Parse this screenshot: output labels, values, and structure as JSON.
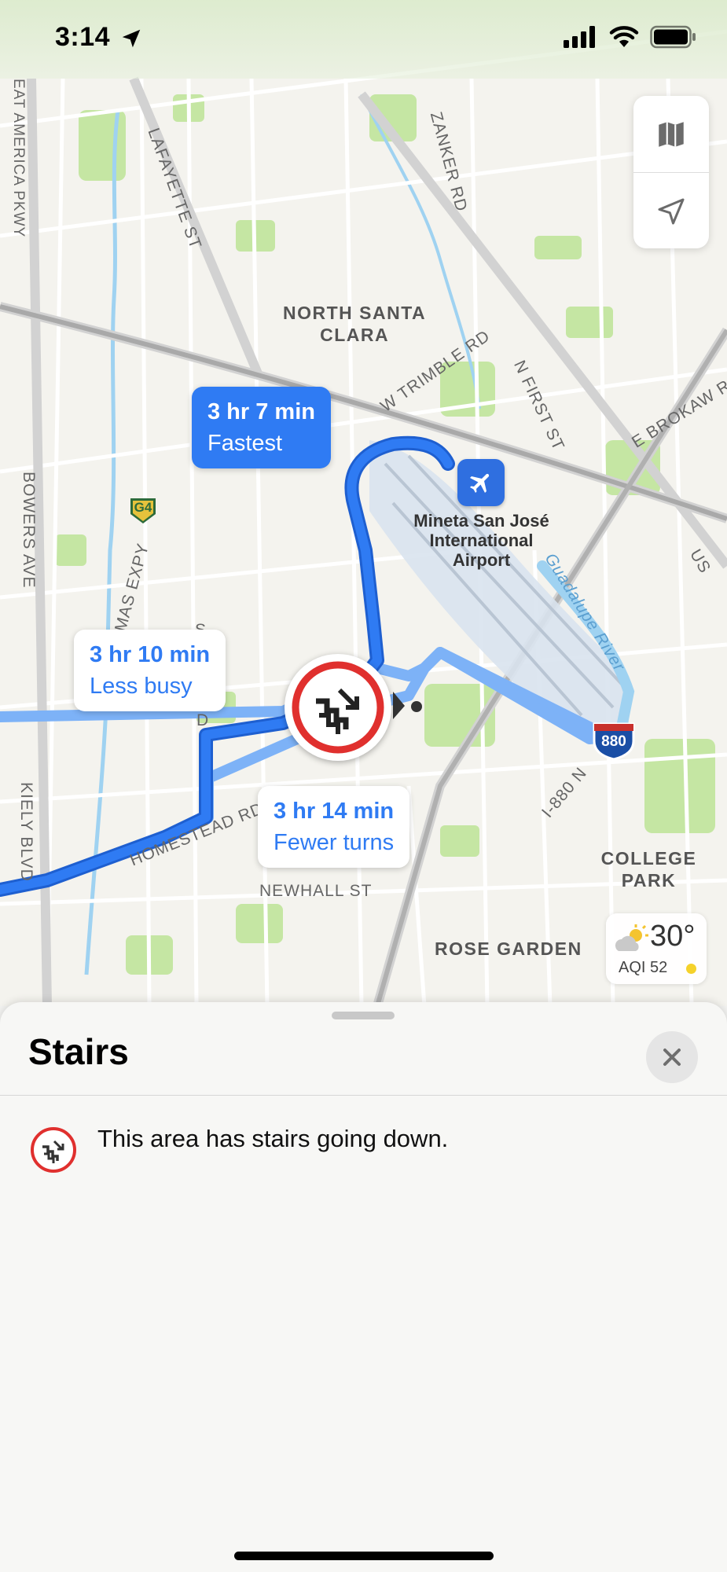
{
  "status_bar": {
    "time": "3:14",
    "icons": [
      "location-arrow-icon",
      "signal-icon",
      "wifi-icon",
      "battery-icon"
    ]
  },
  "map": {
    "street_labels": {
      "east_america_pkwy": "EAT AMERICA PKWY",
      "lafayette": "LAFAYETTE ST",
      "zanker": "ZANKER RD",
      "trimble": "W TRIMBLE RD",
      "first": "N FIRST ST",
      "brokaw": "E BROKAW RD",
      "bowers": "BOWERS AVE",
      "expy": "MAS EXPY",
      "kiely": "KIELY BLVD",
      "homestead": "HOMESTEAD RD",
      "newhall": "NEWHALL ST",
      "i880": "I-880 N",
      "river": "Guadalupe River",
      "s_label": "S",
      "d_label": "D",
      "us_label": "US"
    },
    "districts": {
      "north_santa_clara_1": "NORTH SANTA",
      "north_santa_clara_2": "CLARA",
      "college_park": "COLLEGE PARK",
      "rose_garden": "ROSE GARDEN"
    },
    "airport": {
      "line1": "Mineta San José",
      "line2": "International",
      "line3": "Airport"
    },
    "shields": {
      "g4": "G4",
      "i880": "880"
    },
    "routes": [
      {
        "time": "3 hr 7 min",
        "label": "Fastest",
        "selected": true
      },
      {
        "time": "3 hr 10 min",
        "label": "Less busy",
        "selected": false
      },
      {
        "time": "3 hr 14 min",
        "label": "Fewer turns",
        "selected": false
      }
    ],
    "weather": {
      "temp": "30°",
      "aqi": "AQI 52"
    },
    "colors": {
      "route_primary": "#2f7bf3",
      "route_alt": "#7db2f7",
      "park": "#b9e08f",
      "water": "#9fd2f1",
      "hazard_red": "#e0302e"
    }
  },
  "sheet": {
    "title": "Stairs",
    "description": "This area has stairs going down."
  }
}
